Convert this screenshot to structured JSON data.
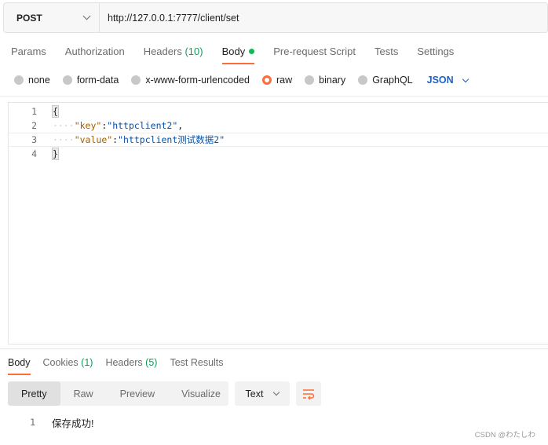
{
  "request": {
    "method": "POST",
    "url": "http://127.0.0.1:7777/client/set"
  },
  "tabs": [
    {
      "label": "Params"
    },
    {
      "label": "Authorization"
    },
    {
      "label": "Headers",
      "count": "(10)"
    },
    {
      "label": "Body",
      "active": true
    },
    {
      "label": "Pre-request Script"
    },
    {
      "label": "Tests"
    },
    {
      "label": "Settings"
    }
  ],
  "body_types": [
    "none",
    "form-data",
    "x-www-form-urlencoded",
    "raw",
    "binary",
    "GraphQL"
  ],
  "body_type_selected": "raw",
  "raw_format": "JSON",
  "editor": {
    "lines": [
      {
        "num": "1",
        "text": "{"
      },
      {
        "num": "2",
        "indent": "····",
        "key": "\"key\"",
        "sep": ":",
        "value": "\"httpclient2\"",
        "tail": ","
      },
      {
        "num": "3",
        "indent": "····",
        "key": "\"value\"",
        "sep": ":",
        "value": "\"httpclient测试数据2\"",
        "tail": ""
      },
      {
        "num": "4",
        "text": "}"
      }
    ]
  },
  "response": {
    "tabs": {
      "body": "Body",
      "cookies": "Cookies",
      "cookies_count": "(1)",
      "headers": "Headers",
      "headers_count": "(5)",
      "test_results": "Test Results"
    },
    "views": [
      "Pretty",
      "Raw",
      "Preview",
      "Visualize"
    ],
    "view_selected": "Pretty",
    "format": "Text",
    "line_num": "1",
    "text": "保存成功!"
  },
  "watermark": "CSDN @わたしわ",
  "colors": {
    "accent": "#ff6c37",
    "count_green": "#0f9d58",
    "json_blue": "#1f61c6",
    "key_color": "#a55d00",
    "string_color": "#0451a5"
  }
}
